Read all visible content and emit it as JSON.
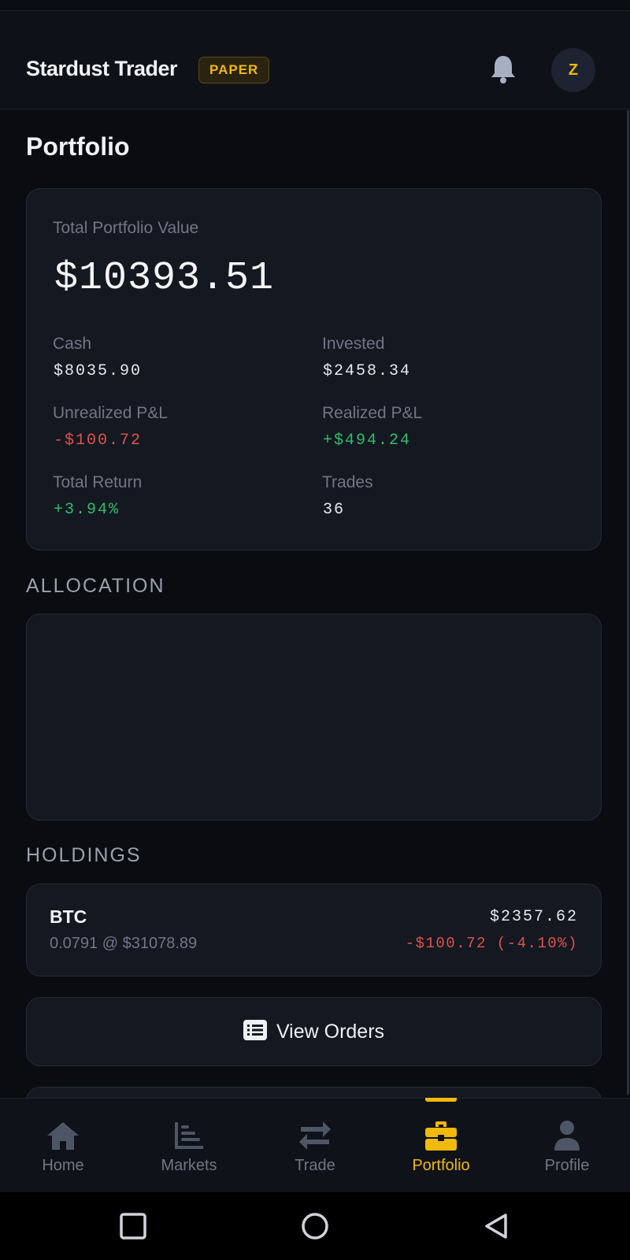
{
  "header": {
    "brand": "Stardust Trader",
    "badge": "PAPER",
    "avatar_initial": "Z",
    "accent_color": "#f0b90b"
  },
  "page_title": "Portfolio",
  "summary": {
    "total_label": "Total Portfolio Value",
    "total_value": "$10393.51",
    "cash_label": "Cash",
    "cash_value": "$8035.90",
    "invested_label": "Invested",
    "invested_value": "$2458.34",
    "unrealized_label": "Unrealized P&L",
    "unrealized_value": "-$100.72",
    "realized_label": "Realized P&L",
    "realized_value": "+$494.24",
    "return_label": "Total Return",
    "return_value": "+3.94%",
    "trades_label": "Trades",
    "trades_value": "36"
  },
  "allocation_title": "ALLOCATION",
  "holdings_title": "HOLDINGS",
  "holdings": [
    {
      "symbol": "BTC",
      "detail": "0.0791 @ $31078.89",
      "value": "$2357.62",
      "change": "-$100.72 (-4.10%)"
    }
  ],
  "view_orders_label": "View Orders",
  "nav": [
    {
      "label": "Home",
      "icon": "home-icon"
    },
    {
      "label": "Markets",
      "icon": "chart-bars-icon"
    },
    {
      "label": "Trade",
      "icon": "swap-arrows-icon"
    },
    {
      "label": "Portfolio",
      "icon": "briefcase-icon",
      "active": true
    },
    {
      "label": "Profile",
      "icon": "user-icon"
    }
  ],
  "colors": {
    "negative": "#e0524a",
    "positive": "#2fbd6b"
  }
}
